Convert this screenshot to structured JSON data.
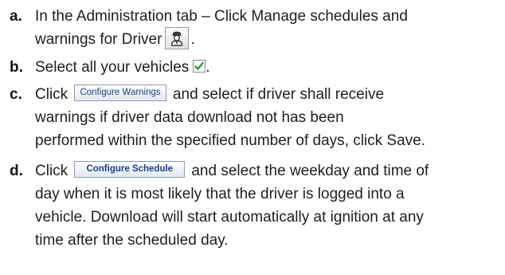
{
  "steps": [
    {
      "letter": "a.",
      "line1": "In the Administration tab – Click Manage schedules and",
      "line2_before": "warnings for Driver",
      "line2_after": "."
    },
    {
      "letter": "b.",
      "before": "Select all your vehicles",
      "after": "."
    },
    {
      "letter": "c.",
      "before": "Click",
      "button": "Configure Warnings",
      "after": "and select if driver shall receive",
      "line2": "warnings if driver data download not has been",
      "line3": "performed within the specified number of days, click Save."
    },
    {
      "letter": "d.",
      "before": "Click",
      "button": "Configure Schedule",
      "after": "and select the weekday and time of",
      "line2": "day when it is most likely that the driver is logged into a",
      "line3": "vehicle. Download will start automatically at ignition at any",
      "line4": "time after the scheduled day."
    }
  ],
  "icons": {
    "driver": "driver-person-icon",
    "check": "checkmark-icon"
  },
  "colors": {
    "check": "#2e9a2e",
    "button_text": "#1c3f8a"
  }
}
